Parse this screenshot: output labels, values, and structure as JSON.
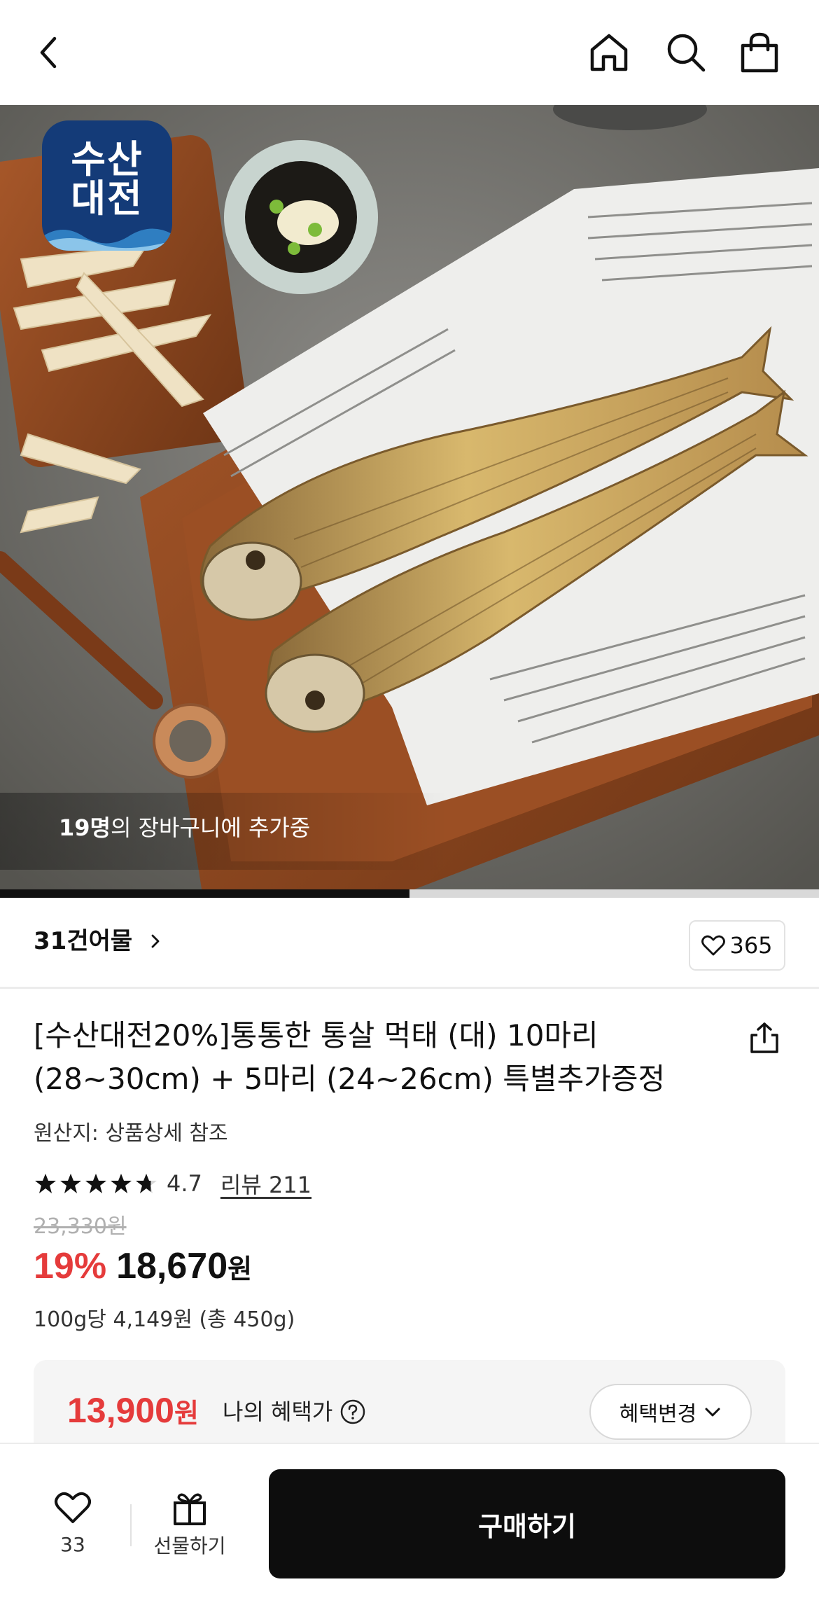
{
  "header": {
    "back_icon": "chevron-left-icon",
    "home_icon": "home-icon",
    "search_icon": "search-icon",
    "cart_icon": "shopping-bag-icon"
  },
  "hero": {
    "logo": {
      "line1": "수산",
      "line2": "대전"
    },
    "cart_count_bold": "19명",
    "cart_count_rest": "의 장바구니에 추가중",
    "slide_progress": 0.5
  },
  "brand": {
    "name": "31건어물",
    "like_count": "365"
  },
  "product": {
    "title": "[수산대전20%]통통한 통살 먹태 (대) 10마리 (28~30cm) + 5마리 (24~26cm) 특별추가증정",
    "origin": "원산지: 상품상세 참조",
    "rating": "4.7",
    "rating_stars": 4.7,
    "review_label": "리뷰 211",
    "original_price": "23,330원",
    "discount": "19%",
    "price": "18,670",
    "price_unit": "원",
    "unit_price": "100g당 4,149원 (총 450g)"
  },
  "benefit": {
    "price": "13,900",
    "price_unit": "원",
    "label": "나의 혜택가",
    "change_button": "혜택변경"
  },
  "bottom": {
    "wish_count": "33",
    "gift_label": "선물하기",
    "buy_label": "구매하기"
  },
  "colors": {
    "accent_red": "#e53b3b",
    "buy_button": "#0d0d0d",
    "logo_blue": "#143b78"
  }
}
